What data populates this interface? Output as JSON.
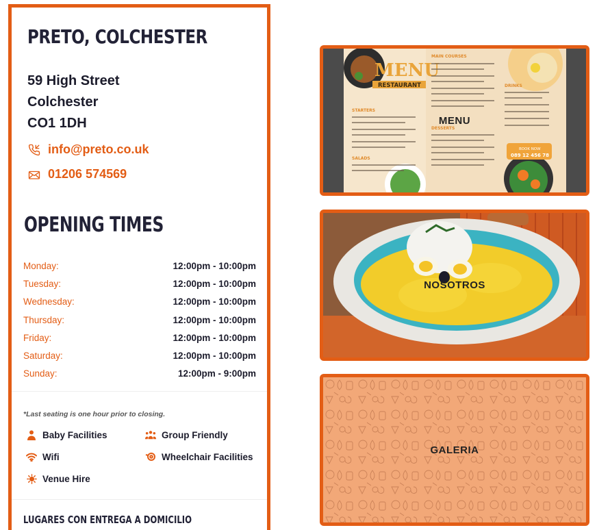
{
  "restaurant": {
    "name": "PRETO, COLCHESTER",
    "address": [
      "59 High Street",
      "Colchester",
      "CO1 1DH"
    ],
    "email": "info@preto.co.uk",
    "phone": "01206 574569"
  },
  "opening": {
    "title": "OPENING TIMES",
    "hours": [
      {
        "day": "Monday:",
        "time": "12:00pm - 10:00pm"
      },
      {
        "day": "Tuesday:",
        "time": "12:00pm - 10:00pm"
      },
      {
        "day": "Wednesday:",
        "time": "12:00pm - 10:00pm"
      },
      {
        "day": "Thursday:",
        "time": "12:00pm - 10:00pm"
      },
      {
        "day": "Friday:",
        "time": "12:00pm - 10:00pm"
      },
      {
        "day": "Saturday:",
        "time": "12:00pm - 10:00pm"
      },
      {
        "day": "Sunday:",
        "time": "12:00pm - 9:00pm"
      }
    ]
  },
  "features": {
    "note": "*Last seating is one hour prior to closing.",
    "items": [
      {
        "label": "Baby Facilities",
        "icon": "person-icon"
      },
      {
        "label": "Group Friendly",
        "icon": "group-icon"
      },
      {
        "label": "Wifi",
        "icon": "wifi-icon"
      },
      {
        "label": "Wheelchair Facilities",
        "icon": "wheelchair-icon"
      },
      {
        "label": "Venue Hire",
        "icon": "sun-icon"
      }
    ]
  },
  "delivery": {
    "title": "LUGARES CON ENTREGA A DOMICILIO"
  },
  "cards": [
    {
      "label": "MENU"
    },
    {
      "label": "NOSOTROS"
    },
    {
      "label": "GALERIA"
    }
  ],
  "menu_image": {
    "title": "MENU",
    "subtitle": "RESTAURANT",
    "sections": [
      "MAIN COURSES",
      "STARTERS",
      "SALADS",
      "DESSERTS",
      "DRINKS"
    ],
    "cta": "BOOK NOW",
    "phone": "089 12 456 78"
  },
  "colors": {
    "accent": "#e35d15",
    "dark": "#222236",
    "galeria_bg": "#f2a878"
  }
}
